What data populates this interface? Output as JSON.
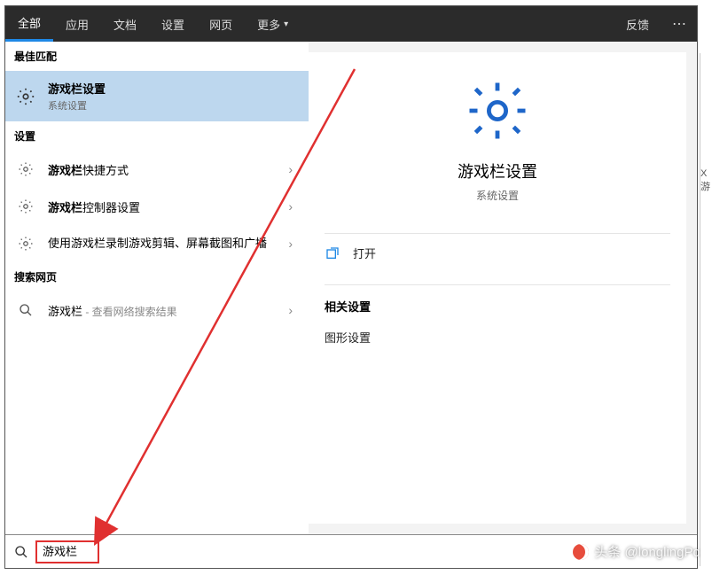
{
  "topbar": {
    "tabs": [
      "全部",
      "应用",
      "文档",
      "设置",
      "网页",
      "更多"
    ],
    "feedback": "反馈"
  },
  "left": {
    "best_match_header": "最佳匹配",
    "best_match": {
      "title": "游戏栏设置",
      "subtitle": "系统设置"
    },
    "settings_header": "设置",
    "settings_items": [
      {
        "prefix": "游戏栏",
        "suffix": "快捷方式"
      },
      {
        "prefix": "游戏栏",
        "suffix": "控制器设置"
      },
      {
        "prefix": "",
        "suffix": "使用游戏栏录制游戏剪辑、屏幕截图和广播"
      }
    ],
    "web_header": "搜索网页",
    "web_item": {
      "term": "游戏栏",
      "hint": " - 查看网络搜索结果"
    }
  },
  "right": {
    "title": "游戏栏设置",
    "subtitle": "系统设置",
    "open_label": "打开",
    "related_header": "相关设置",
    "related_item": "图形设置"
  },
  "search": {
    "value": "游戏栏"
  },
  "watermark": "头条 @longlingPc",
  "side_fragment": "X游"
}
